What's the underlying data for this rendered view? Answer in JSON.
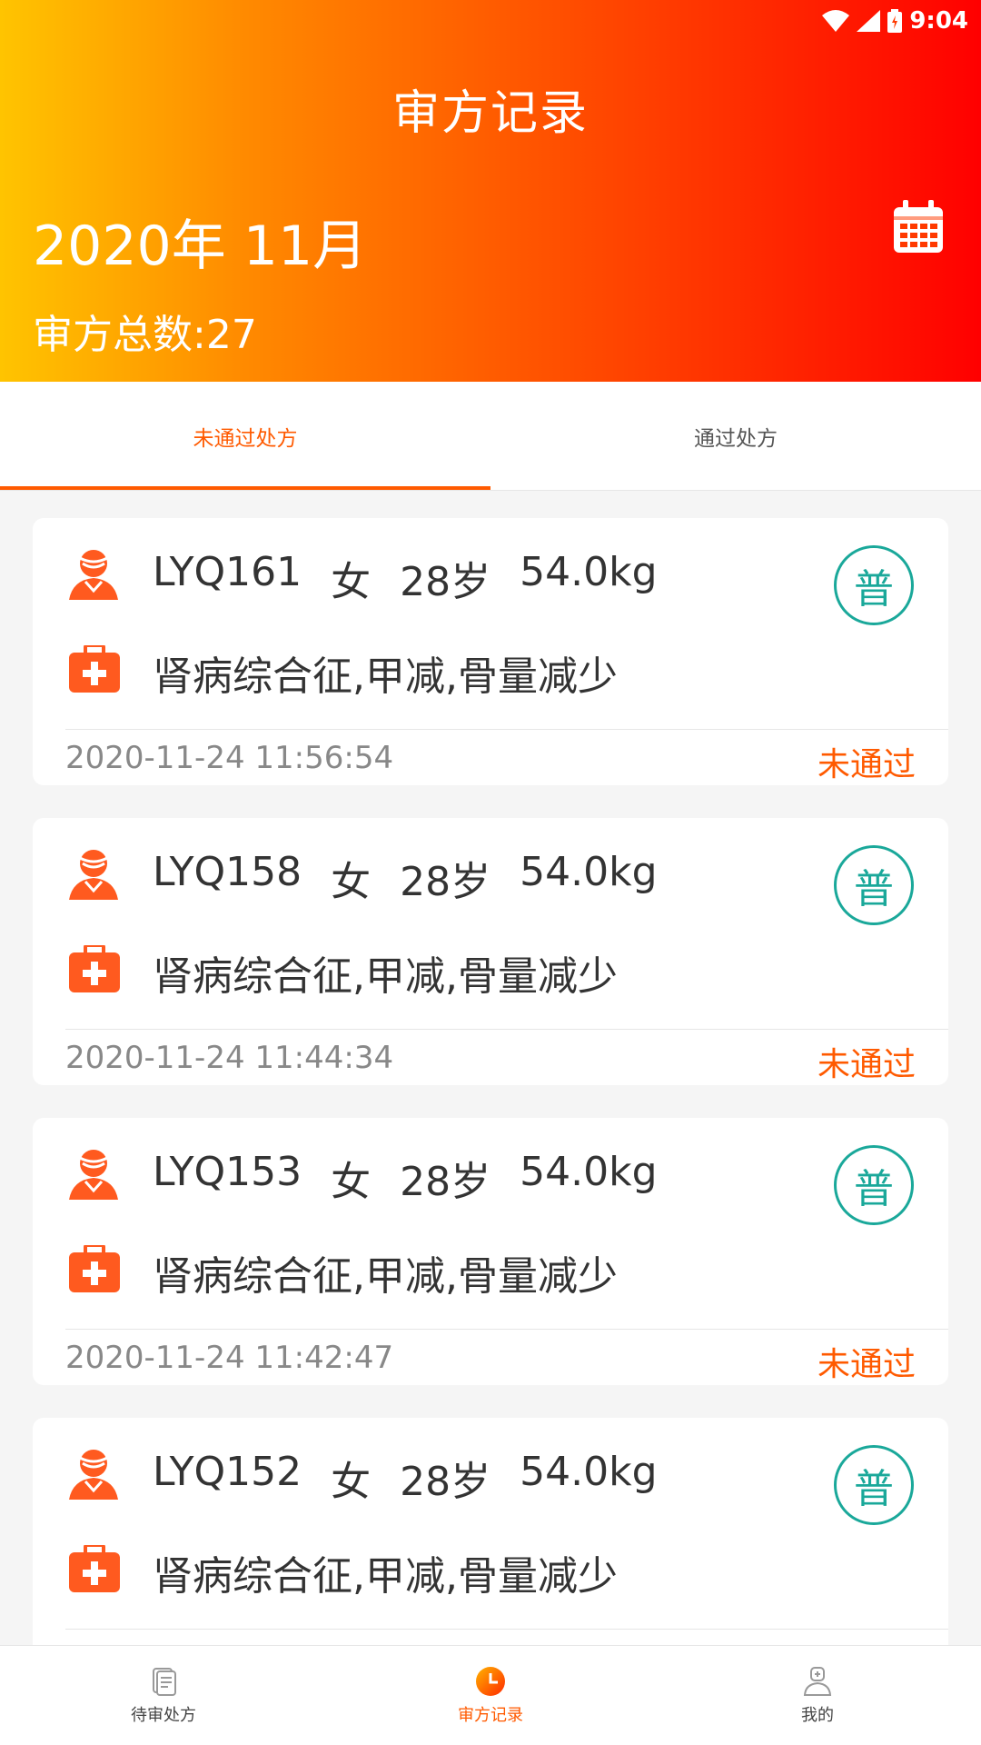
{
  "status_bar": {
    "time": "9:04"
  },
  "header": {
    "title": "审方记录",
    "month": "2020年 11月",
    "total": "审方总数:27"
  },
  "tabs": [
    {
      "label": "未通过处方",
      "active": true
    },
    {
      "label": "通过处方",
      "active": false
    }
  ],
  "records": [
    {
      "id": "LYQ161",
      "gender": "女",
      "age": "28岁",
      "weight": "54.0kg",
      "diagnosis": "肾病综合征,甲减,骨量减少",
      "badge": "普",
      "time": "2020-11-24 11:56:54",
      "status": "未通过"
    },
    {
      "id": "LYQ158",
      "gender": "女",
      "age": "28岁",
      "weight": "54.0kg",
      "diagnosis": "肾病综合征,甲减,骨量减少",
      "badge": "普",
      "time": "2020-11-24 11:44:34",
      "status": "未通过"
    },
    {
      "id": "LYQ153",
      "gender": "女",
      "age": "28岁",
      "weight": "54.0kg",
      "diagnosis": "肾病综合征,甲减,骨量减少",
      "badge": "普",
      "time": "2020-11-24 11:42:47",
      "status": "未通过"
    },
    {
      "id": "LYQ152",
      "gender": "女",
      "age": "28岁",
      "weight": "54.0kg",
      "diagnosis": "肾病综合征,甲减,骨量减少",
      "badge": "普",
      "time": "",
      "status": ""
    }
  ],
  "bottom_nav": [
    {
      "label": "待审处方",
      "icon": "document-icon",
      "active": false
    },
    {
      "label": "审方记录",
      "icon": "clock-icon",
      "active": true
    },
    {
      "label": "我的",
      "icon": "doctor-icon",
      "active": false
    }
  ],
  "colors": {
    "accent": "#ff5a00",
    "badge": "#1aa89a",
    "header_start": "#ffc400",
    "header_end": "#ff0000"
  }
}
